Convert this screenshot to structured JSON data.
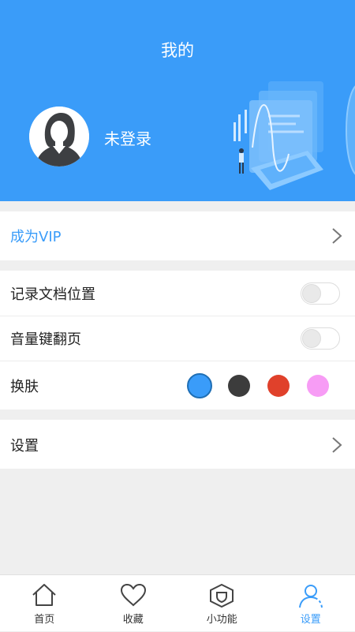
{
  "header": {
    "title": "我的",
    "login_status": "未登录"
  },
  "vip": {
    "label": "成为VIP"
  },
  "options": {
    "record_position": {
      "label": "记录文档位置",
      "enabled": false
    },
    "volume_key_page": {
      "label": "音量键翻页",
      "enabled": false
    },
    "skin": {
      "label": "换肤",
      "colors": [
        "#3a9cf9",
        "#3c3c3c",
        "#e0412b",
        "#f79cf5"
      ],
      "selected_index": 0
    }
  },
  "settings": {
    "label": "设置"
  },
  "tabbar": {
    "tabs": [
      {
        "label": "首页",
        "icon": "home-icon"
      },
      {
        "label": "收藏",
        "icon": "heart-icon"
      },
      {
        "label": "小功能",
        "icon": "shield-icon"
      },
      {
        "label": "设置",
        "icon": "user-icon"
      }
    ],
    "active_index": 3
  },
  "colors": {
    "accent": "#3a9cf9",
    "background": "#efefef"
  }
}
